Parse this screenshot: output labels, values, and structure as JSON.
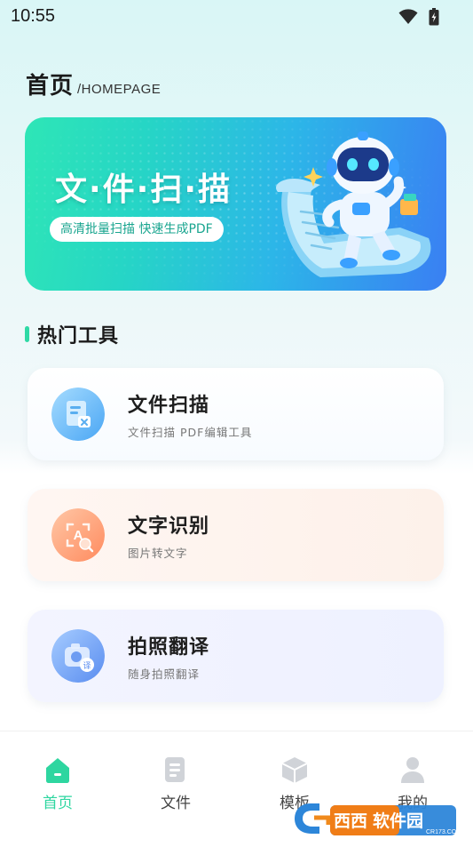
{
  "status_bar": {
    "time": "10:55"
  },
  "header": {
    "title": "首页",
    "subtitle": "/HOMEPAGE"
  },
  "banner": {
    "title": "文·件·扫·描",
    "tagline": "高清批量扫描  快速生成PDF"
  },
  "section": {
    "title": "热门工具"
  },
  "tools": [
    {
      "title": "文件扫描",
      "subtitle": "文件扫描 PDF编辑工具",
      "icon": "document-scan-icon"
    },
    {
      "title": "文字识别",
      "subtitle": "图片转文字",
      "icon": "text-recognition-icon"
    },
    {
      "title": "拍照翻译",
      "subtitle": "随身拍照翻译",
      "icon": "camera-translate-icon"
    }
  ],
  "tabs": [
    {
      "label": "首页",
      "icon": "home-icon",
      "active": true
    },
    {
      "label": "文件",
      "icon": "file-list-icon",
      "active": false
    },
    {
      "label": "模板",
      "icon": "cube-icon",
      "active": false
    },
    {
      "label": "我的",
      "icon": "person-icon",
      "active": false
    }
  ],
  "watermark": {
    "text": "西西软件园",
    "domain": "CR173.COM"
  },
  "colors": {
    "accent": "#2fd9a5",
    "tab_inactive": "#c9ccd2",
    "tab_active": "#2ed6a0"
  }
}
